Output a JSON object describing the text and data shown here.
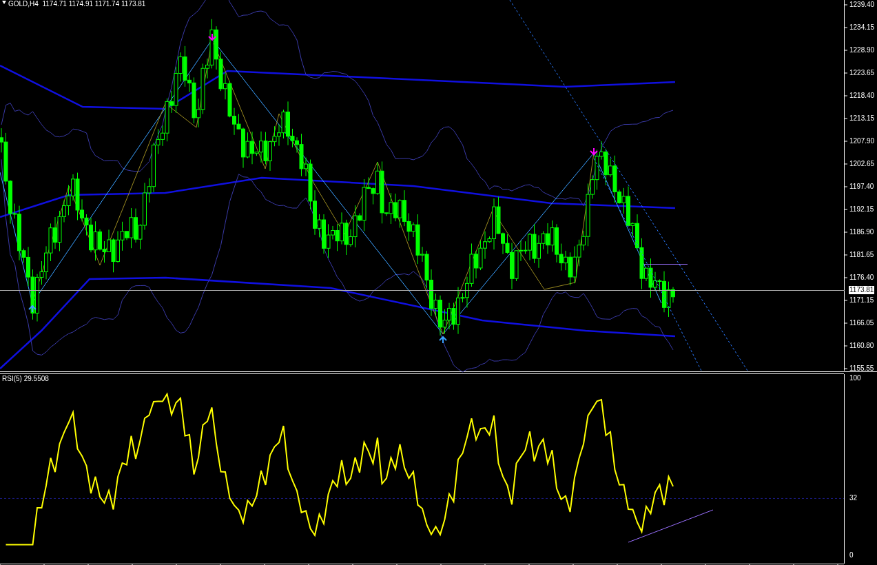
{
  "chart_header": {
    "title": "GOLD,H4  1174.71 1174.91 1171.74 1173.81"
  },
  "price_axis": {
    "labels": [
      "1239.40",
      "1234.15",
      "1228.90",
      "1223.65",
      "1218.40",
      "1213.15",
      "1207.90",
      "1202.65",
      "1197.40",
      "1192.15",
      "1186.90",
      "1181.65",
      "1176.40",
      "1171.15",
      "1166.05",
      "1160.80",
      "1155.55"
    ],
    "current_price": "1173.81"
  },
  "rsi_panel": {
    "title": "RSI(5) 29.5508",
    "axis_labels": [
      "100",
      "32",
      "0"
    ]
  }
}
